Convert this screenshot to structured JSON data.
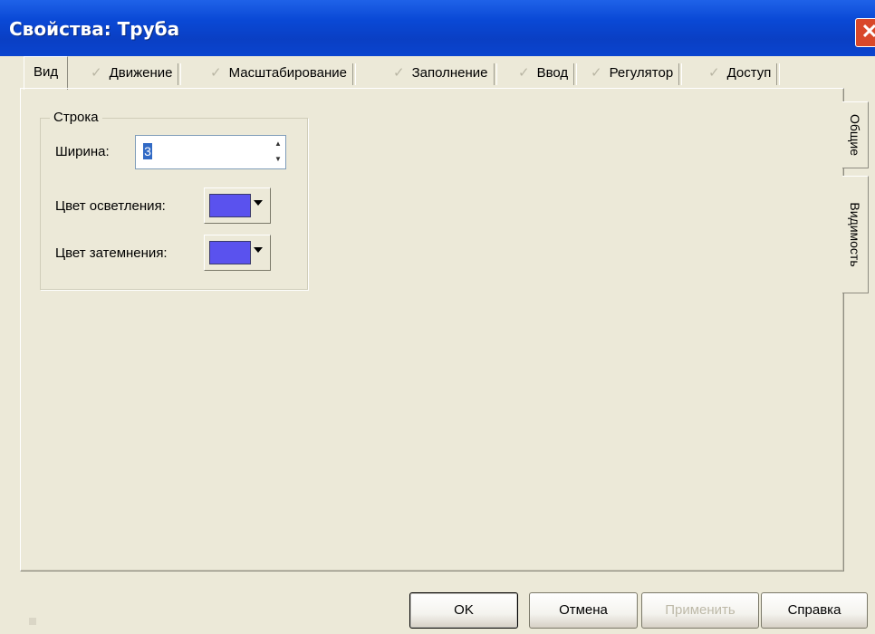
{
  "window": {
    "title": "Свойства: Труба",
    "close_label": "✕"
  },
  "tabs": [
    {
      "label": "Вид",
      "active": true
    },
    {
      "label": "Движение",
      "active": false
    },
    {
      "label": "Масштабирование",
      "active": false
    },
    {
      "label": "Заполнение",
      "active": false
    },
    {
      "label": "Ввод",
      "active": false
    },
    {
      "label": "Регулятор",
      "active": false
    },
    {
      "label": "Доступ",
      "active": false
    }
  ],
  "side_tabs": [
    {
      "label": "Общие",
      "active": true
    },
    {
      "label": "Видимость",
      "active": false
    }
  ],
  "group": {
    "caption": "Строка",
    "width_label": "Ширина:",
    "width_value": "3",
    "light_color_label": "Цвет осветления:",
    "light_color": "#5a52ee",
    "dark_color_label": "Цвет затемнения:",
    "dark_color": "#5a52ee"
  },
  "buttons": {
    "ok": "OK",
    "cancel": "Отмена",
    "apply": "Применить",
    "help": "Справка"
  },
  "icons": {
    "spin_up": "spin-up-icon",
    "spin_down": "spin-down-icon",
    "dropdown": "chevron-down-icon"
  }
}
